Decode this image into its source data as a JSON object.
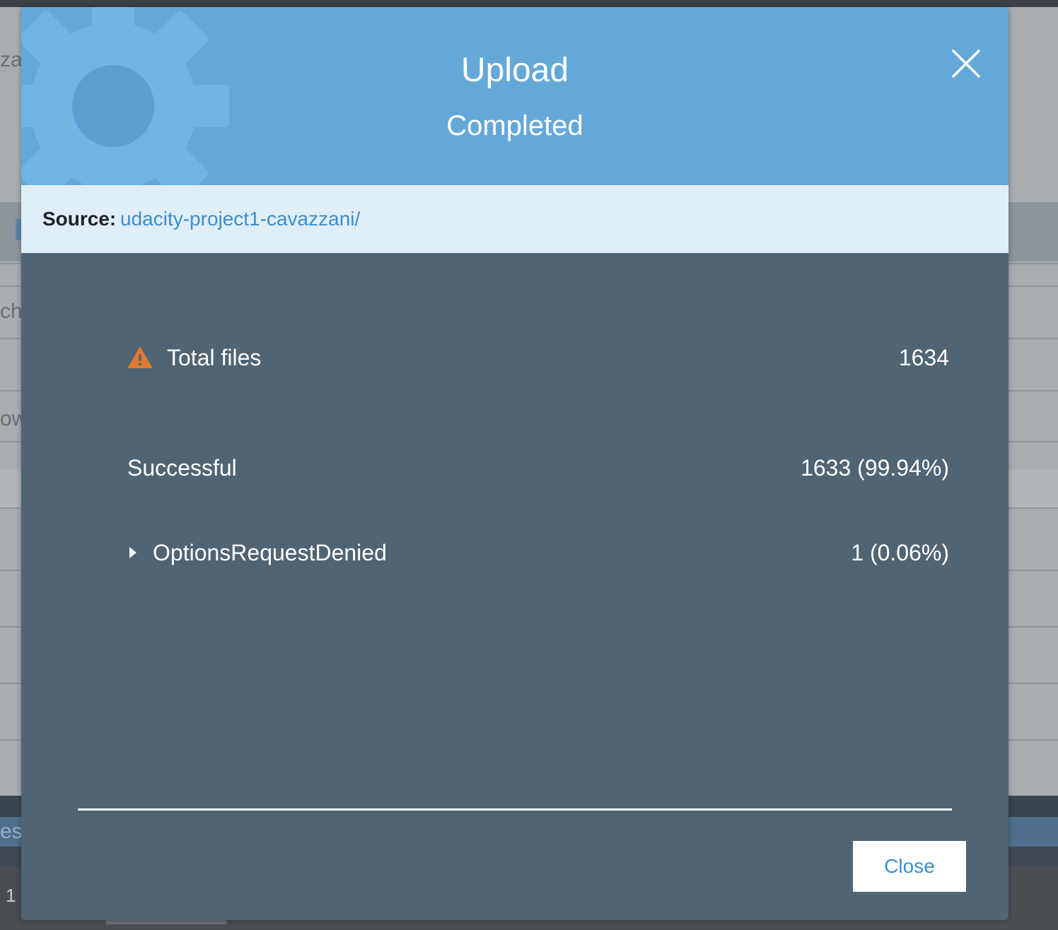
{
  "background": {
    "fragments": [
      "za",
      "ch",
      "ow",
      "es",
      "1"
    ]
  },
  "dialog": {
    "title": "Upload",
    "subtitle": "Completed",
    "close_icon": "close-x-icon",
    "header_decoration": "gear-icon",
    "colors": {
      "header": "#64a8d8",
      "source_bar": "#e0eef8",
      "body": "#516473",
      "link": "#3a8fd0",
      "warning": "#e07a2e"
    }
  },
  "source": {
    "label": "Source:",
    "value": "udacity-project1-cavazzani/"
  },
  "stats": {
    "total": {
      "icon": "warning-triangle-icon",
      "label": "Total files",
      "value": "1634"
    },
    "successful": {
      "label": "Successful",
      "value": "1633 (99.94%)"
    },
    "denied": {
      "icon": "caret-right-icon",
      "label": "OptionsRequestDenied",
      "value": "1 (0.06%)"
    }
  },
  "footer": {
    "close_label": "Close"
  }
}
